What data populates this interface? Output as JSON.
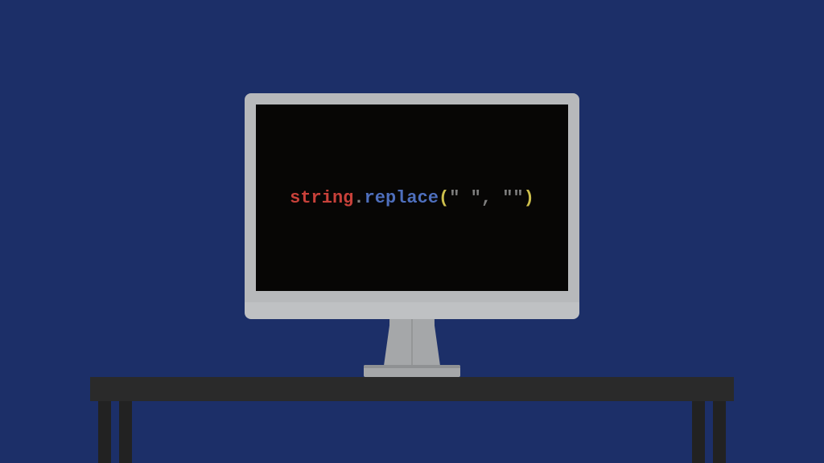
{
  "code": {
    "object": "string",
    "dot": ".",
    "method": "replace",
    "open_paren": "(",
    "arg1": "\" \"",
    "comma": ", ",
    "arg2": "\"\"",
    "close_paren": ")"
  },
  "colors": {
    "background": "#1c2f68",
    "screen": "#070605",
    "bezel": "#b7b9bb",
    "chin": "#bfc1c3",
    "stand": "#a5a7a9",
    "desk": "#2a2a2a",
    "code_red": "#c8413a",
    "code_dim": "#7f7f7f",
    "code_blue": "#4e6fbd",
    "code_yellow": "#cdbf4c"
  }
}
